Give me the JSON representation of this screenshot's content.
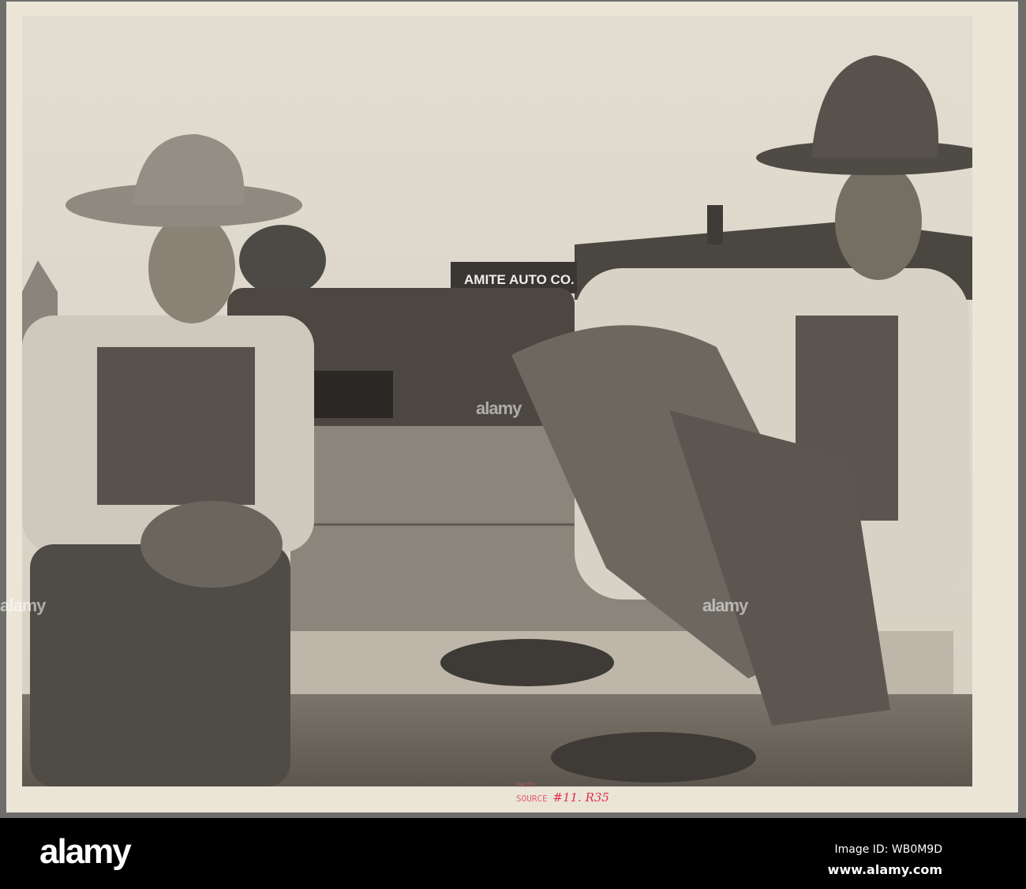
{
  "photo": {
    "sign_text": "AMITE AUTO CO.",
    "stamp_line1": "PHOTO",
    "stamp_line2": "SOURCE",
    "stamp_number": "#11. R35"
  },
  "watermark": "alamy",
  "footer": {
    "logo": "alamy",
    "image_id": "Image ID: WB0M9D",
    "website": "www.alamy.com"
  }
}
